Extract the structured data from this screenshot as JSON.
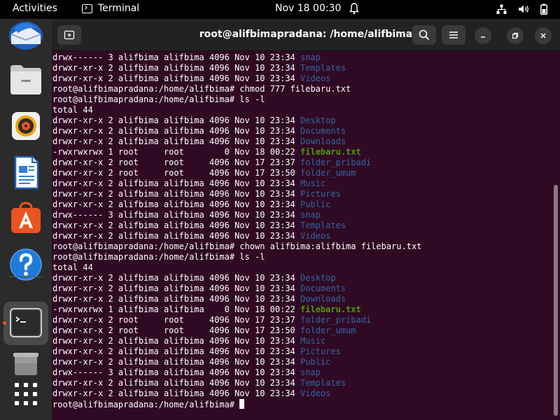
{
  "topbar": {
    "activities": "Activities",
    "app_name": "Terminal",
    "clock": "Nov 18  00:30"
  },
  "window": {
    "title": "root@alifbimapradana: /home/alifbima"
  },
  "dock": {
    "items": [
      "thunderbird-icon",
      "files-icon",
      "rhythmbox-icon",
      "writer-icon",
      "app-center-icon",
      "help-icon",
      "terminal-icon",
      "trash-icon",
      "show-apps-icon"
    ],
    "active": "terminal-icon"
  },
  "terminal": {
    "prompt": "root@alifbimapradana:/home/alifbima#",
    "lines": [
      {
        "type": "entry",
        "text": "drwx------ 3 alifbima alifbima 4096 Nov 10 23:34 ",
        "name": "snap",
        "kind": "dir"
      },
      {
        "type": "entry",
        "text": "drwxr-xr-x 2 alifbima alifbima 4096 Nov 10 23:34 ",
        "name": "Templates",
        "kind": "dir"
      },
      {
        "type": "entry",
        "text": "drwxr-xr-x 2 alifbima alifbima 4096 Nov 10 23:34 ",
        "name": "Videos",
        "kind": "dir"
      },
      {
        "type": "cmd",
        "text": "root@alifbimapradana:/home/alifbima# chmod 777 filebaru.txt"
      },
      {
        "type": "cmd",
        "text": "root@alifbimapradana:/home/alifbima# ls -l"
      },
      {
        "type": "plain",
        "text": "total 44"
      },
      {
        "type": "entry",
        "text": "drwxr-xr-x 2 alifbima alifbima 4096 Nov 10 23:34 ",
        "name": "Desktop",
        "kind": "dir"
      },
      {
        "type": "entry",
        "text": "drwxr-xr-x 2 alifbima alifbima 4096 Nov 10 23:34 ",
        "name": "Documents",
        "kind": "dir"
      },
      {
        "type": "entry",
        "text": "drwxr-xr-x 2 alifbima alifbima 4096 Nov 10 23:34 ",
        "name": "Downloads",
        "kind": "dir"
      },
      {
        "type": "entry",
        "text": "-rwxrwxrwx 1 root     root        0 Nov 18 00:22 ",
        "name": "filebaru.txt",
        "kind": "exe"
      },
      {
        "type": "entry",
        "text": "drwxr-xr-x 2 root     root     4096 Nov 17 23:37 ",
        "name": "folder_pribadi",
        "kind": "dir"
      },
      {
        "type": "entry",
        "text": "drwxr-xr-x 2 root     root     4096 Nov 17 23:50 ",
        "name": "folder_umum",
        "kind": "dir"
      },
      {
        "type": "entry",
        "text": "drwxr-xr-x 2 alifbima alifbima 4096 Nov 10 23:34 ",
        "name": "Music",
        "kind": "dir"
      },
      {
        "type": "entry",
        "text": "drwxr-xr-x 2 alifbima alifbima 4096 Nov 10 23:34 ",
        "name": "Pictures",
        "kind": "dir"
      },
      {
        "type": "entry",
        "text": "drwxr-xr-x 2 alifbima alifbima 4096 Nov 10 23:34 ",
        "name": "Public",
        "kind": "dir"
      },
      {
        "type": "entry",
        "text": "drwx------ 3 alifbima alifbima 4096 Nov 10 23:34 ",
        "name": "snap",
        "kind": "dir"
      },
      {
        "type": "entry",
        "text": "drwxr-xr-x 2 alifbima alifbima 4096 Nov 10 23:34 ",
        "name": "Templates",
        "kind": "dir"
      },
      {
        "type": "entry",
        "text": "drwxr-xr-x 2 alifbima alifbima 4096 Nov 10 23:34 ",
        "name": "Videos",
        "kind": "dir"
      },
      {
        "type": "cmd",
        "text": "root@alifbimapradana:/home/alifbima# chown alifbima:alifbima filebaru.txt"
      },
      {
        "type": "cmd",
        "text": "root@alifbimapradana:/home/alifbima# ls -l"
      },
      {
        "type": "plain",
        "text": "total 44"
      },
      {
        "type": "entry",
        "text": "drwxr-xr-x 2 alifbima alifbima 4096 Nov 10 23:34 ",
        "name": "Desktop",
        "kind": "dir"
      },
      {
        "type": "entry",
        "text": "drwxr-xr-x 2 alifbima alifbima 4096 Nov 10 23:34 ",
        "name": "Documents",
        "kind": "dir"
      },
      {
        "type": "entry",
        "text": "drwxr-xr-x 2 alifbima alifbima 4096 Nov 10 23:34 ",
        "name": "Downloads",
        "kind": "dir"
      },
      {
        "type": "entry",
        "text": "-rwxrwxrwx 1 alifbima alifbima    0 Nov 18 00:22 ",
        "name": "filebaru.txt",
        "kind": "exe"
      },
      {
        "type": "entry",
        "text": "drwxr-xr-x 2 root     root     4096 Nov 17 23:37 ",
        "name": "folder_pribadi",
        "kind": "dir"
      },
      {
        "type": "entry",
        "text": "drwxr-xr-x 2 root     root     4096 Nov 17 23:50 ",
        "name": "folder_umum",
        "kind": "dir"
      },
      {
        "type": "entry",
        "text": "drwxr-xr-x 2 alifbima alifbima 4096 Nov 10 23:34 ",
        "name": "Music",
        "kind": "dir"
      },
      {
        "type": "entry",
        "text": "drwxr-xr-x 2 alifbima alifbima 4096 Nov 10 23:34 ",
        "name": "Pictures",
        "kind": "dir"
      },
      {
        "type": "entry",
        "text": "drwxr-xr-x 2 alifbima alifbima 4096 Nov 10 23:34 ",
        "name": "Public",
        "kind": "dir"
      },
      {
        "type": "entry",
        "text": "drwx------ 3 alifbima alifbima 4096 Nov 10 23:34 ",
        "name": "snap",
        "kind": "dir"
      },
      {
        "type": "entry",
        "text": "drwxr-xr-x 2 alifbima alifbima 4096 Nov 10 23:34 ",
        "name": "Templates",
        "kind": "dir"
      },
      {
        "type": "entry",
        "text": "drwxr-xr-x 2 alifbima alifbima 4096 Nov 10 23:34 ",
        "name": "Videos",
        "kind": "dir"
      },
      {
        "type": "prompt",
        "text": "root@alifbimapradana:/home/alifbima# "
      }
    ]
  },
  "colors": {
    "terminal_bg": "#300a24",
    "directory": "#3465a4",
    "executable": "#4e9a06",
    "accent": "#e95420"
  }
}
